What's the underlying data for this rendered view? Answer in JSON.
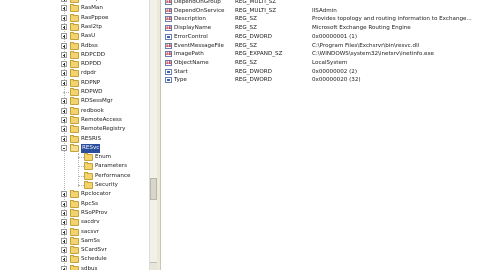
{
  "tree": {
    "items": [
      {
        "label": "RasIsp",
        "expander": "plus"
      },
      {
        "label": "RasMan",
        "expander": "plus"
      },
      {
        "label": "RasPppoe",
        "expander": "plus"
      },
      {
        "label": "Rasl2tp",
        "expander": "plus"
      },
      {
        "label": "RasU",
        "expander": "plus"
      },
      {
        "label": "Rdbss",
        "expander": "plus"
      },
      {
        "label": "RDPCDD",
        "expander": "plus"
      },
      {
        "label": "RDPDD",
        "expander": "plus"
      },
      {
        "label": "rdpdr",
        "expander": "plus"
      },
      {
        "label": "RDPNP",
        "expander": "plus"
      },
      {
        "label": "RDPWD",
        "expander": "none"
      },
      {
        "label": "RDSessMgr",
        "expander": "plus"
      },
      {
        "label": "redbook",
        "expander": "plus"
      },
      {
        "label": "RemoteAccess",
        "expander": "plus"
      },
      {
        "label": "RemoteRegistry",
        "expander": "plus"
      },
      {
        "label": "RESRIS",
        "expander": "plus"
      },
      {
        "label": "RESvc",
        "expander": "minus",
        "selected": true
      },
      {
        "label": "Enum",
        "child": true
      },
      {
        "label": "Parameters",
        "child": true
      },
      {
        "label": "Performance",
        "child": true
      },
      {
        "label": "Security",
        "child": true
      },
      {
        "label": "Rpclocator",
        "expander": "plus"
      },
      {
        "label": "RpcSs",
        "expander": "plus"
      },
      {
        "label": "RSoPProv",
        "expander": "plus"
      },
      {
        "label": "sacdrv",
        "expander": "plus"
      },
      {
        "label": "sacsvr",
        "expander": "plus"
      },
      {
        "label": "SamSs",
        "expander": "plus"
      },
      {
        "label": "SCardSvr",
        "expander": "plus"
      },
      {
        "label": "Schedule",
        "expander": "plus"
      },
      {
        "label": "sdbus",
        "expander": "plus"
      }
    ]
  },
  "values": {
    "rows": [
      {
        "name": "DependOnGroup",
        "type": "REG_MULTI_SZ",
        "data": "",
        "icon": "str"
      },
      {
        "name": "DependOnService",
        "type": "REG_MULTI_SZ",
        "data": "IISAdmin",
        "icon": "str"
      },
      {
        "name": "Description",
        "type": "REG_SZ",
        "data": "Provides topology and routing information to Exchange...",
        "icon": "str"
      },
      {
        "name": "DisplayName",
        "type": "REG_SZ",
        "data": "Microsoft Exchange Routing Engine",
        "icon": "str"
      },
      {
        "name": "ErrorControl",
        "type": "REG_DWORD",
        "data": "0x00000001 (1)",
        "icon": "bin"
      },
      {
        "name": "EventMessageFile",
        "type": "REG_SZ",
        "data": "C:\\Program Files\\Exchsrvr\\bin\\resvc.dll",
        "icon": "str"
      },
      {
        "name": "ImagePath",
        "type": "REG_EXPAND_SZ",
        "data": "C:\\WINDOWS\\system32\\inetsrv\\inetinfo.exe",
        "icon": "str"
      },
      {
        "name": "ObjectName",
        "type": "REG_SZ",
        "data": "LocalSystem",
        "icon": "str"
      },
      {
        "name": "Start",
        "type": "REG_DWORD",
        "data": "0x00000002 (2)",
        "icon": "bin"
      },
      {
        "name": "Type",
        "type": "REG_DWORD",
        "data": "0x00000020 (32)",
        "icon": "bin"
      }
    ]
  }
}
